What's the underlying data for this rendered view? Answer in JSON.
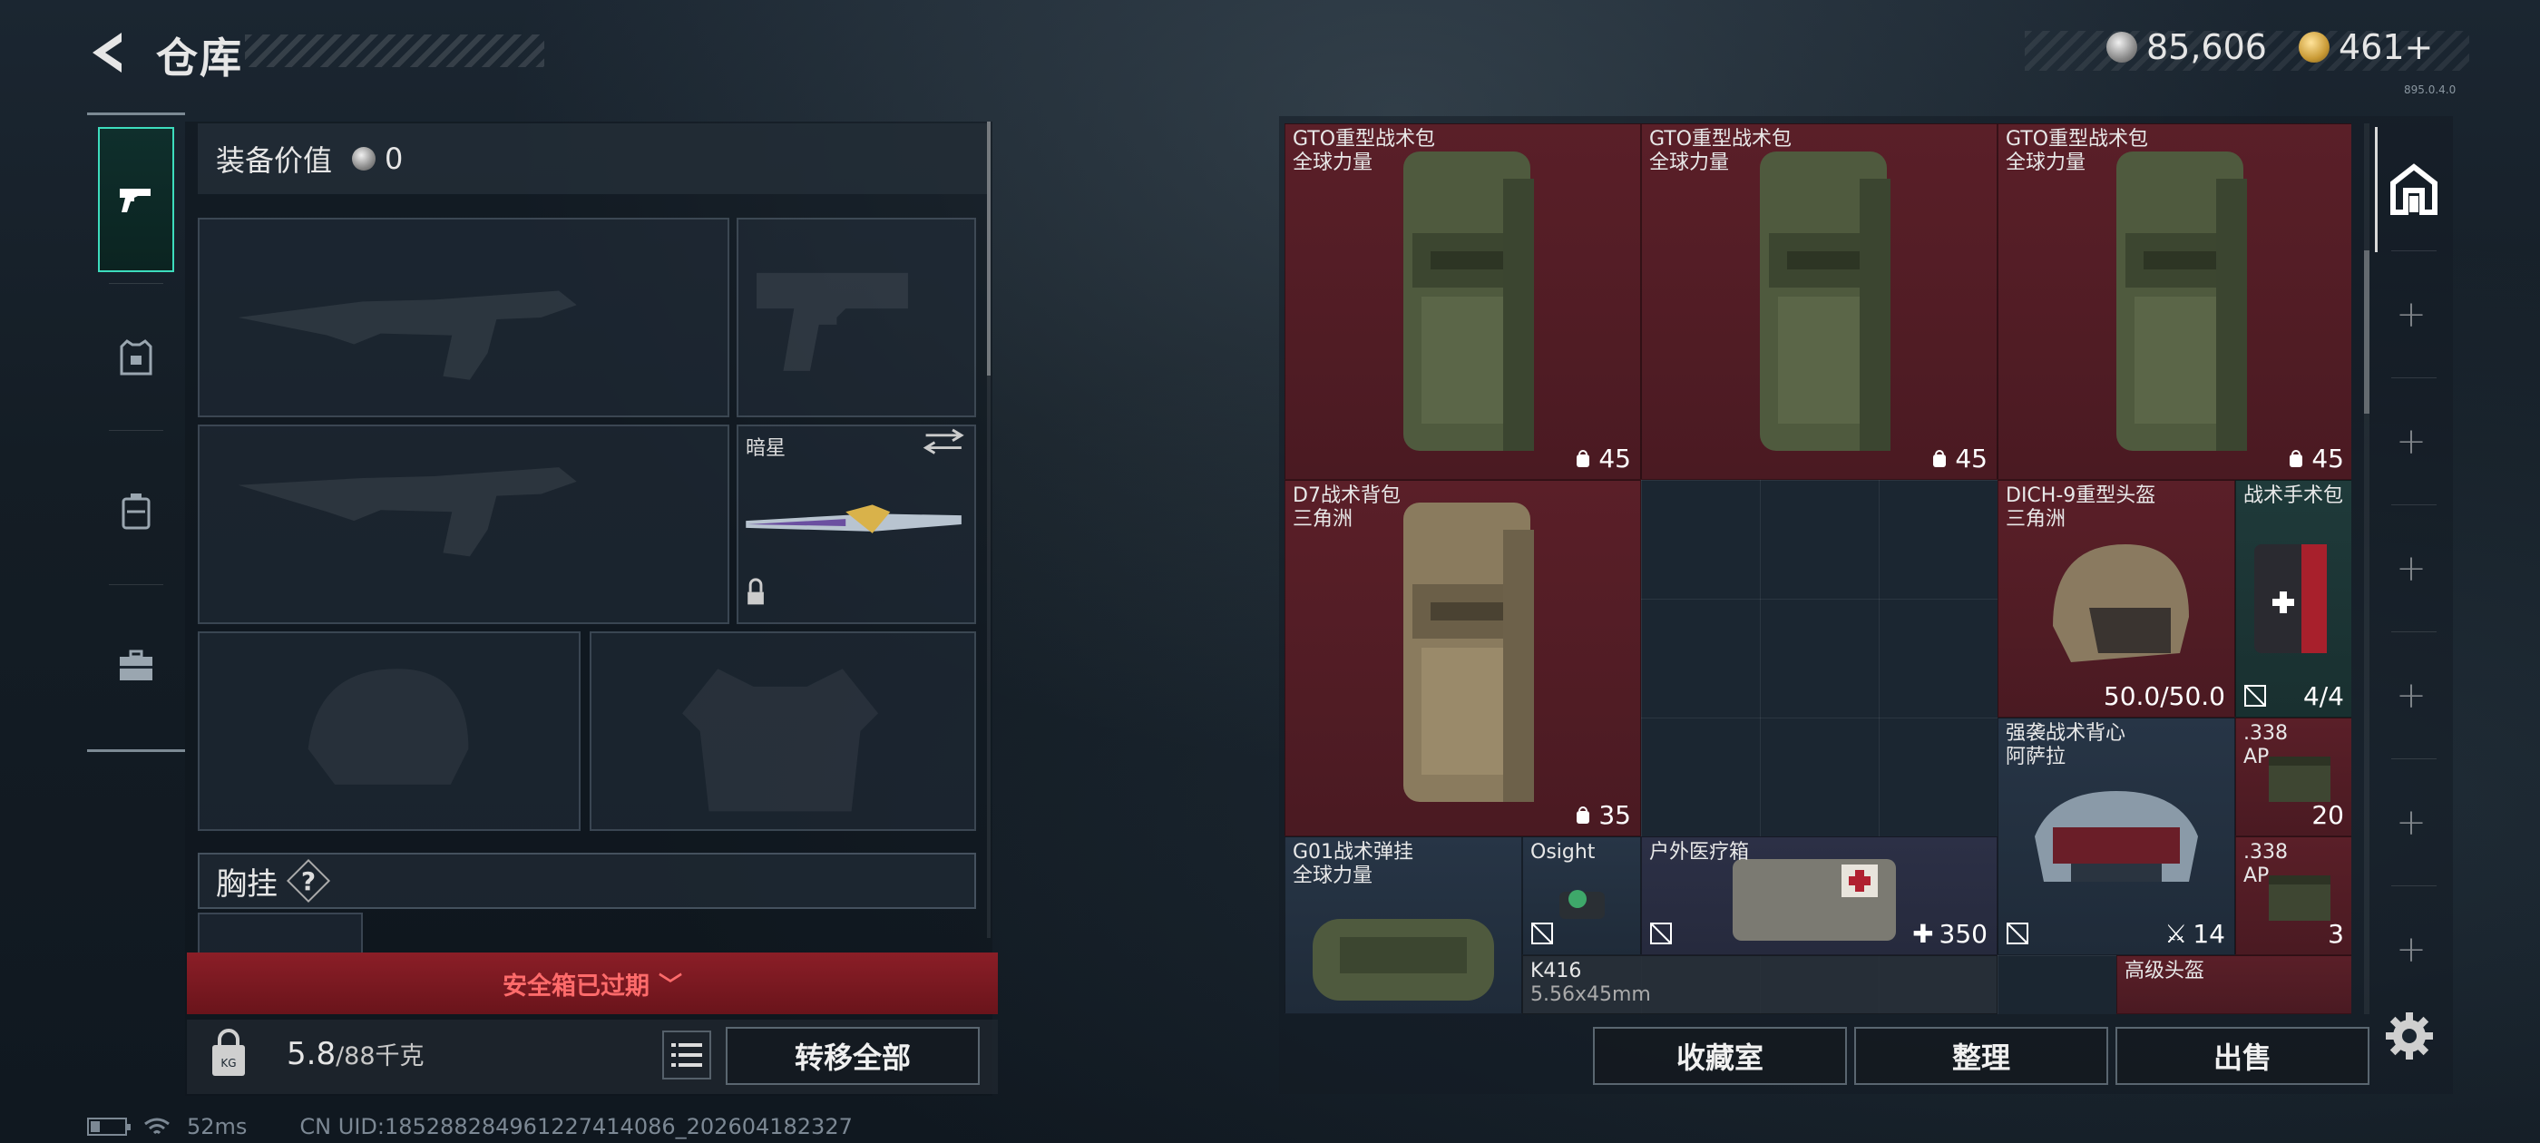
{
  "header": {
    "title": "仓库"
  },
  "currency": {
    "silver": "85,606",
    "gold": "461+",
    "version": "895.0.4.0"
  },
  "loadout": {
    "equip_value_label": "装备价值",
    "equip_value": "0",
    "melee_name": "暗星",
    "chest_label": "胸挂",
    "help": "?"
  },
  "bottom": {
    "expired_text": "安全箱已过期",
    "weight_current": "5.8",
    "weight_max": "/88千克",
    "transfer_all": "转移全部"
  },
  "status": {
    "ping": "52ms",
    "uid": "CN UID:185288284961227414086_202604182327"
  },
  "stash": {
    "items": [
      {
        "name": "GTO重型战术包",
        "sub": "全球力量",
        "count": "45"
      },
      {
        "name": "GTO重型战术包",
        "sub": "全球力量",
        "count": "45"
      },
      {
        "name": "GTO重型战术包",
        "sub": "全球力量",
        "count": "45"
      },
      {
        "name": "D7战术背包",
        "sub": "三角洲",
        "count": "35"
      },
      {
        "name": "DICH-9重型头盔",
        "sub": "三角洲",
        "count": "50.0/50.0"
      },
      {
        "name": "战术手术包",
        "sub": "",
        "count": "4/4"
      },
      {
        "name": "强袭战术背心",
        "sub": "阿萨拉",
        "count": "14"
      },
      {
        "name": ".338",
        "sub": "AP",
        "count": "20"
      },
      {
        "name": ".338",
        "sub": "AP",
        "count": "3"
      },
      {
        "name": "G01战术弹挂",
        "sub": "全球力量",
        "count": ""
      },
      {
        "name": "Osight",
        "sub": "",
        "count": ""
      },
      {
        "name": "户外医疗箱",
        "sub": "",
        "count": "350"
      },
      {
        "name": "K416",
        "sub": "5.56x45mm",
        "count": ""
      },
      {
        "name": "高级头盔",
        "sub": "",
        "count": ""
      }
    ],
    "btn_collection": "收藏室",
    "btn_sort": "整理",
    "btn_sell": "出售"
  },
  "colors": {
    "accent": "#3ddcbd",
    "rarity_red": "#5a1f28",
    "expired": "#8b1e27"
  },
  "icons": [
    "back-arrow-icon",
    "pistol-icon",
    "armor-icon",
    "backpack-icon",
    "briefcase-icon",
    "silver-coin-icon",
    "gold-coin-icon",
    "settings-icon",
    "stash-house-icon"
  ]
}
